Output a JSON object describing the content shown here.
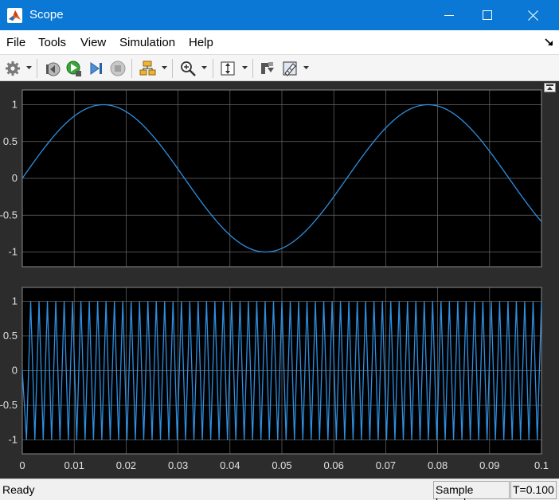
{
  "window": {
    "title": "Scope"
  },
  "menu": {
    "items": [
      "File",
      "Tools",
      "View",
      "Simulation",
      "Help"
    ]
  },
  "toolbar": {
    "buttons": [
      "gear-icon",
      "step-back-icon",
      "run-icon",
      "step-forward-icon",
      "stop-icon",
      "signal-selector-icon",
      "zoom-in-icon",
      "scale-axes-icon",
      "highlight-icon",
      "measurement-ruler-icon"
    ]
  },
  "colors": {
    "line": "#2f8fe0",
    "plot_bg": "#000000",
    "frame_bg": "#2c2c2c",
    "grid": "#6a6a6a",
    "axis_text": "#e0e0e0",
    "title_bar": "#0a78d4"
  },
  "chart_data": [
    {
      "type": "line",
      "x_range": [
        0,
        0.1
      ],
      "ylim": [
        -1.2,
        1.2
      ],
      "y_ticks": [
        "1",
        "0.5",
        "0",
        "-0.5",
        "-1"
      ],
      "x_ticks": [],
      "grid": true,
      "signal": {
        "function": "sine",
        "amplitude": 1,
        "frequency_hz": 16
      }
    },
    {
      "type": "line",
      "x_range": [
        0,
        0.1
      ],
      "ylim": [
        -1.2,
        1.2
      ],
      "y_ticks": [
        "1",
        "0.5",
        "0",
        "-0.5",
        "-1"
      ],
      "x_ticks": [
        "0",
        "0.01",
        "0.02",
        "0.03",
        "0.04",
        "0.05",
        "0.06",
        "0.07",
        "0.08",
        "0.09",
        "0.1"
      ],
      "grid": true,
      "signal": {
        "function": "triangle",
        "amplitude": 1,
        "frequency_hz": 1000,
        "sample_period": 0.0005
      }
    }
  ],
  "status": {
    "text": "Ready",
    "mode": "Sample based",
    "time": "T=0.100"
  }
}
